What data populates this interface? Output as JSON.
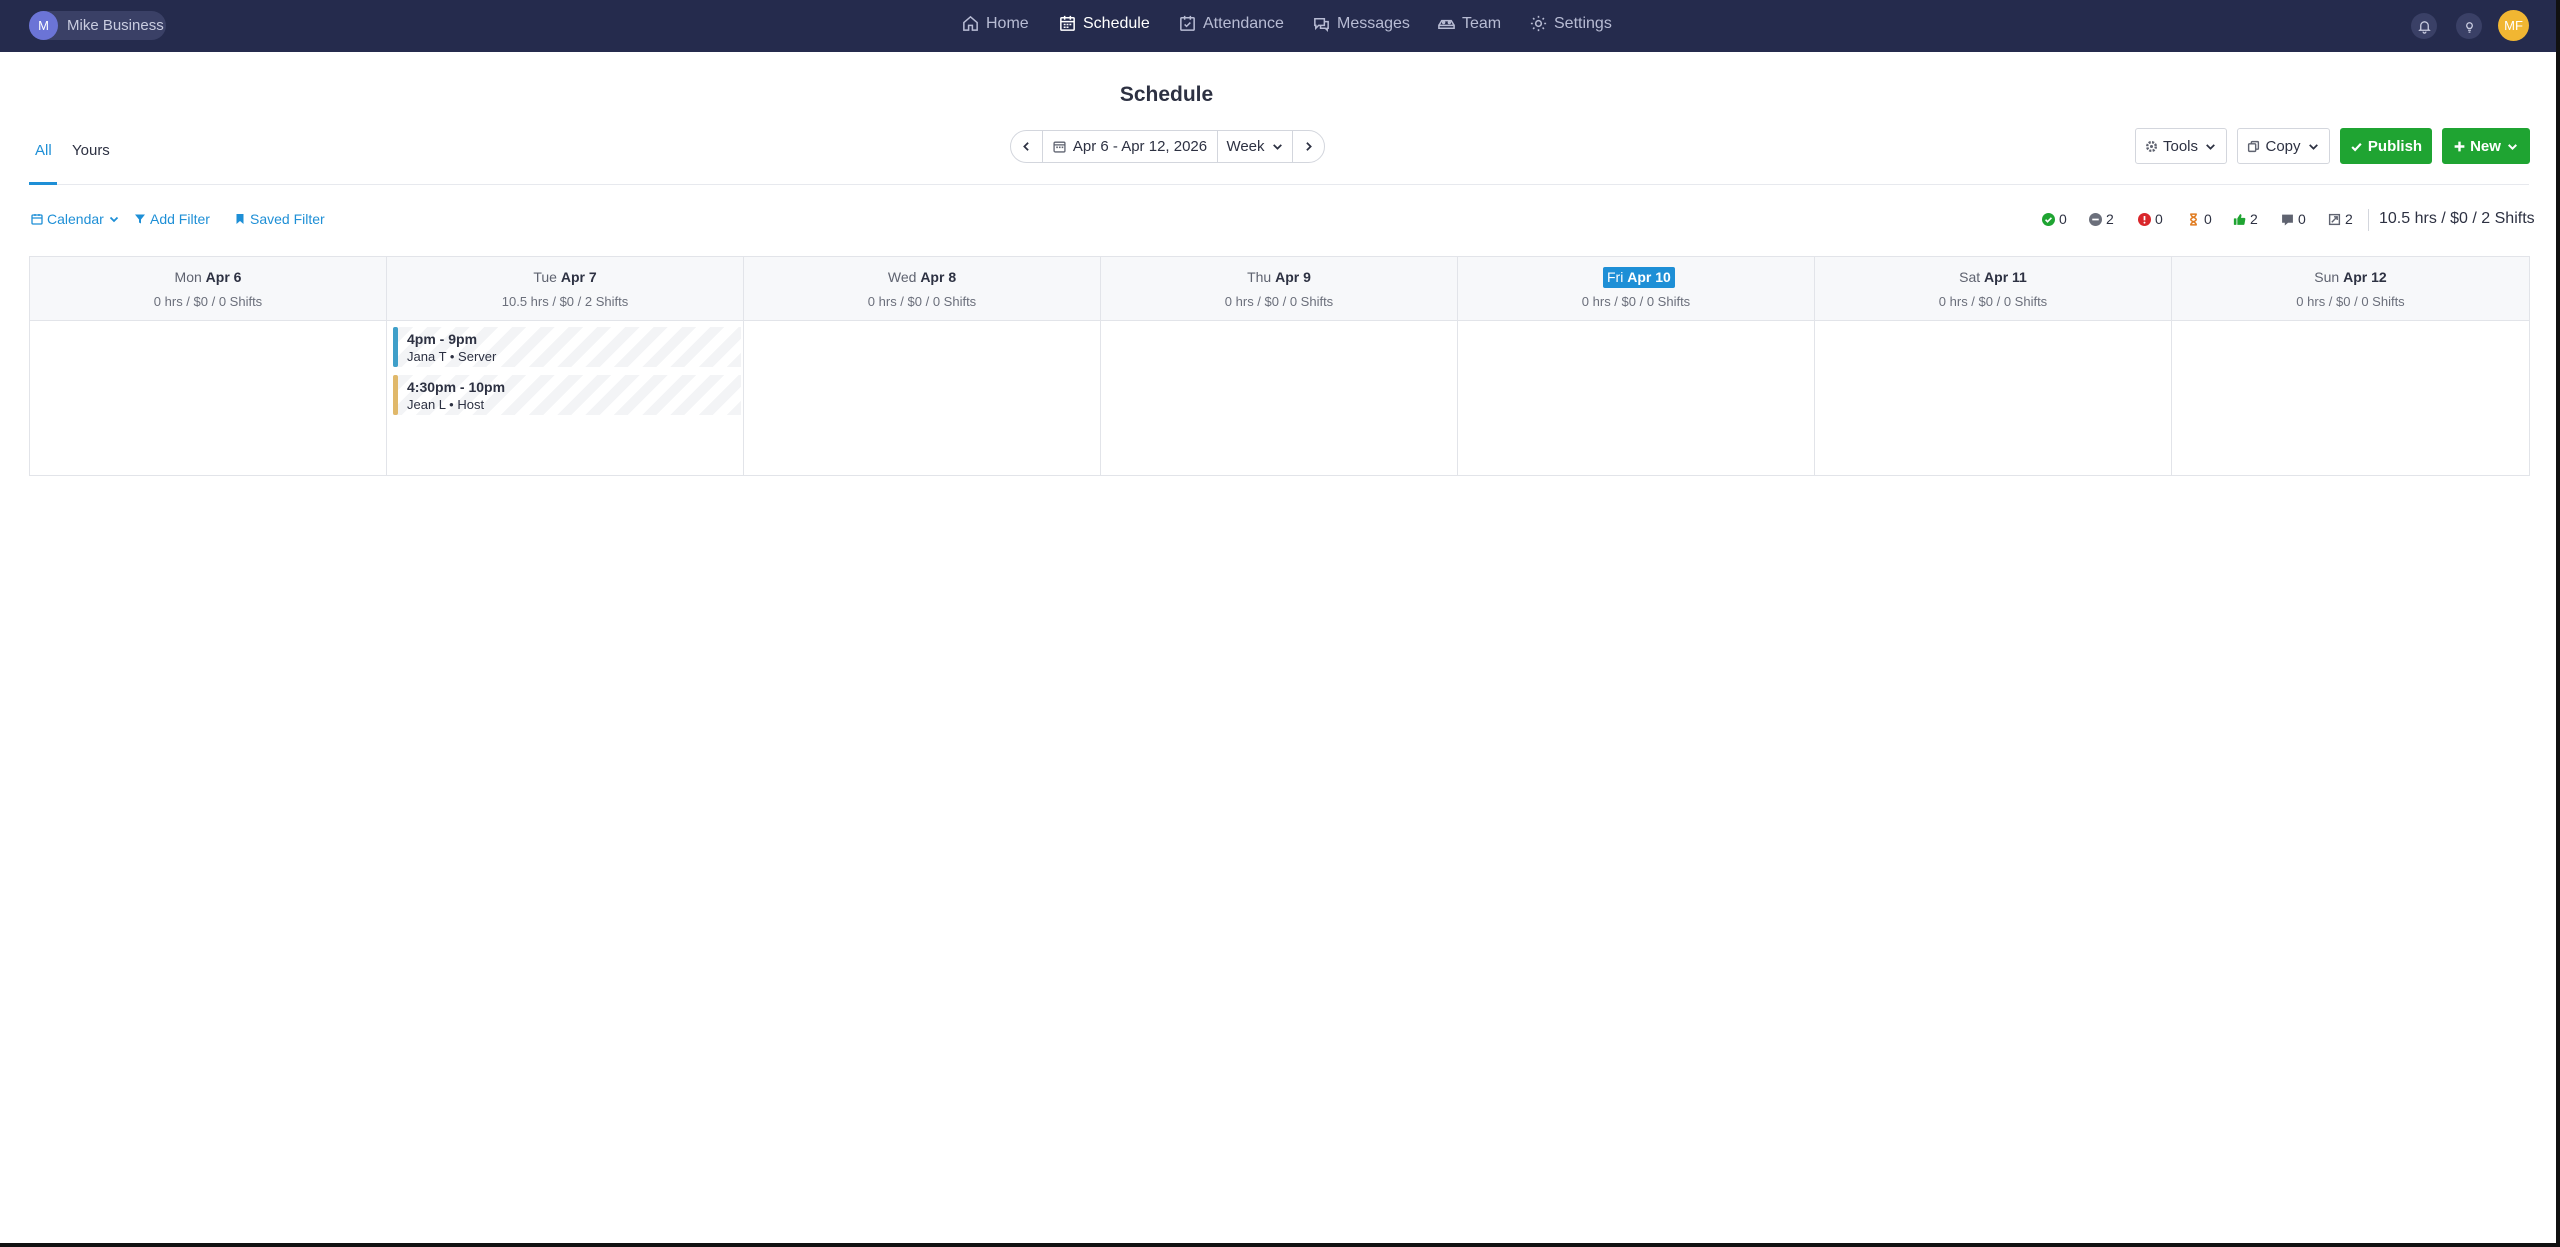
{
  "business": {
    "initial": "M",
    "name": "Mike Business"
  },
  "nav": {
    "home": "Home",
    "schedule": "Schedule",
    "attendance": "Attendance",
    "messages": "Messages",
    "team": "Team",
    "settings": "Settings"
  },
  "user": {
    "initials": "MF"
  },
  "page": {
    "title": "Schedule"
  },
  "tabs": {
    "all": "All",
    "yours": "Yours"
  },
  "range": {
    "label": "Apr 6 - Apr 12, 2026",
    "view": "Week"
  },
  "actions": {
    "tools": "Tools",
    "copy": "Copy",
    "publish": "Publish",
    "new": "New"
  },
  "filters": {
    "calendar": "Calendar",
    "add": "Add Filter",
    "saved": "Saved Filter"
  },
  "stats": {
    "confirmed": "0",
    "unconfirmed": "2",
    "conflicts": "0",
    "pending": "0",
    "approved": "2",
    "notes": "0",
    "open": "2"
  },
  "totals": "10.5 hrs / $0 / 2 Shifts",
  "colors": {
    "accent": "#1e8fd6",
    "green": "#1fa432",
    "navbar": "#252b4d",
    "server": "#3f9fc9",
    "host": "#e0b86a"
  },
  "days": [
    {
      "dow": "Mon",
      "date": "Apr 6",
      "summary": "0 hrs / $0 / 0 Shifts"
    },
    {
      "dow": "Tue",
      "date": "Apr 7",
      "summary": "10.5 hrs / $0 / 2 Shifts"
    },
    {
      "dow": "Wed",
      "date": "Apr 8",
      "summary": "0 hrs / $0 / 0 Shifts"
    },
    {
      "dow": "Thu",
      "date": "Apr 9",
      "summary": "0 hrs / $0 / 0 Shifts"
    },
    {
      "dow": "Fri",
      "date": "Apr 10",
      "summary": "0 hrs / $0 / 0 Shifts"
    },
    {
      "dow": "Sat",
      "date": "Apr 11",
      "summary": "0 hrs / $0 / 0 Shifts"
    },
    {
      "dow": "Sun",
      "date": "Apr 12",
      "summary": "0 hrs / $0 / 0 Shifts"
    }
  ],
  "shifts": [
    {
      "time": "4pm - 9pm",
      "who": "Jana T • Server"
    },
    {
      "time": "4:30pm - 10pm",
      "who": "Jean L • Host"
    }
  ]
}
